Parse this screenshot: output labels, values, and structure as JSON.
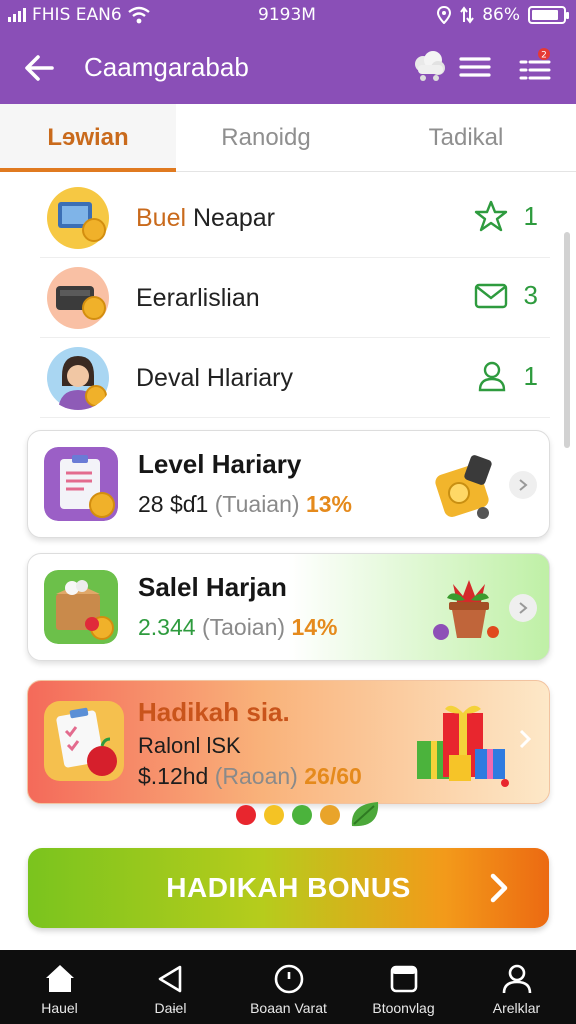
{
  "status_bar": {
    "carrier": "FHIS EAN6",
    "time": "9193M",
    "battery": "86%"
  },
  "app_bar": {
    "title": "Caamgarabab",
    "back_icon": "arrow-left-icon",
    "actions": [
      "cloud-icon",
      "menu-icon",
      "filter-list-icon"
    ],
    "notification_badge_color": "#e53935"
  },
  "tabs": [
    {
      "label": "Lɘwian",
      "active": true
    },
    {
      "label": "Ranoidg",
      "active": false
    },
    {
      "label": "Tadikal",
      "active": false
    }
  ],
  "list": [
    {
      "label_highlight": "Buel",
      "label_rest": " Neapar",
      "icon": "star-outline-icon",
      "count": "1"
    },
    {
      "label_highlight": "",
      "label_rest": "Eerarlislian",
      "icon": "mail-outline-icon",
      "count": "3"
    },
    {
      "label_highlight": "",
      "label_rest": "Deval Hlariary",
      "icon": "user-outline-icon",
      "count": "1"
    }
  ],
  "cards": [
    {
      "title": "Level Hariary",
      "num": "28 $ɗ1",
      "paren": "(Tuaian)",
      "pct": "13%"
    },
    {
      "title": "Salel Harjan",
      "num": "2.344",
      "paren": "(Taoian)",
      "pct": "14%"
    },
    {
      "title": "Hadikah sia.",
      "subtitle": "Ralonl lSK",
      "num": "$.12hd",
      "paren": "(Raoan)",
      "pct": "26/60"
    }
  ],
  "bonus_button": {
    "label": "HADIKAH BONUS"
  },
  "bottom_nav": [
    {
      "label": "Hauel",
      "icon": "home-icon"
    },
    {
      "label": "Daɨel",
      "icon": "back-triangle-icon"
    },
    {
      "label": "Boaan Varat",
      "icon": "circle-icon"
    },
    {
      "label": "Btoonvlag",
      "icon": "square-icon"
    },
    {
      "label": "Arelklar",
      "icon": "profile-icon"
    }
  ],
  "colors": {
    "brand_purple": "#8a4fb7",
    "accent_orange": "#e07a20",
    "success_green": "#2e9b3e",
    "nav_bg": "#0e0e0e"
  }
}
